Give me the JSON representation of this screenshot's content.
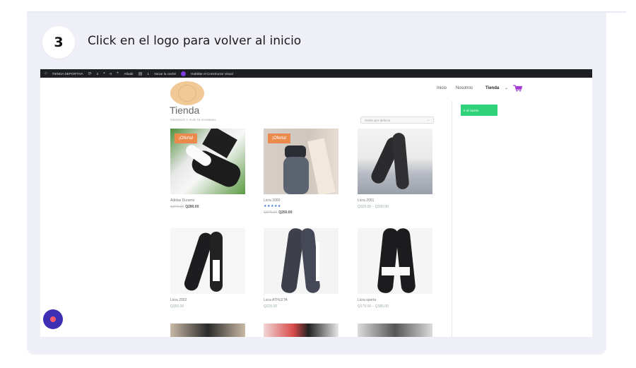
{
  "step": {
    "number": "3",
    "text": "Click en el logo para volver al inicio"
  },
  "admin_bar": {
    "site": "TIENDA DEPORTIVA",
    "updates": "2",
    "comments": "0",
    "add_new": "Añadir",
    "cache_count": "1",
    "clear_cache": "Vaciar la caché",
    "builder": "Habilitar el Constructor visual"
  },
  "nav": {
    "inicio": "Inicio",
    "nosotros": "Nosotros",
    "tienda": "Tienda",
    "tienda_caret": "⌄"
  },
  "sidebar": {
    "button": "Ir al carrito"
  },
  "shop": {
    "title": "Tienda",
    "results": "Mostrando 1–9 de 16 resultados",
    "order": "Orden por defecto",
    "order_caret": "⌄"
  },
  "products": [
    {
      "name": "Adidas Duramo",
      "old_price": "Q370.00",
      "price": "Q280.00",
      "badge": "¡Oferta!"
    },
    {
      "name": "Licra 2000",
      "stars": "★★★★★",
      "old_price": "Q275.00",
      "price": "Q250.00",
      "badge": "¡Oferta!"
    },
    {
      "name": "Licra 2001",
      "price_range": "Q325.00 – Q330.00"
    },
    {
      "name": "Licra 2002",
      "price_range": "Q250.00"
    },
    {
      "name": "Licra ATHLETA",
      "price_range": "Q225.00"
    },
    {
      "name": "Licra sporta",
      "price_range": "Q175.00 – Q185.00"
    }
  ],
  "colors": {
    "accent_green": "#2fd27a",
    "badge_orange": "#ec8a4d",
    "logo_highlight": "#f0c997",
    "chat_bubble": "#3e2fb3"
  }
}
